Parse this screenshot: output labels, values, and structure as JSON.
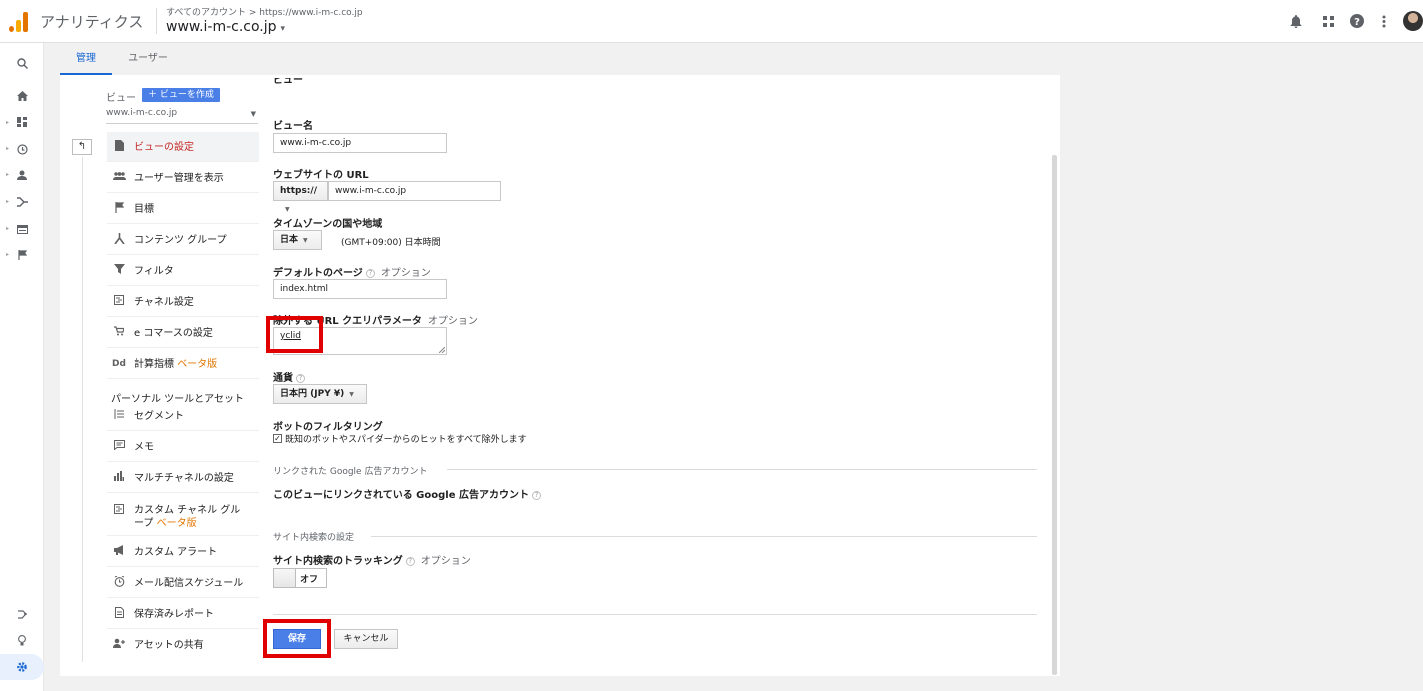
{
  "header": {
    "app_title": "アナリティクス",
    "breadcrumb": "すべてのアカウント > https://www.i-m-c.co.jp",
    "property": "www.i-m-c.co.jp",
    "property_caret": "▾",
    "icons": [
      "bell-icon",
      "apps-grid-icon",
      "help-icon",
      "more-vert-icon"
    ]
  },
  "rail": {
    "icons": [
      "search-icon",
      "home-icon",
      "customization-icon",
      "realtime-icon",
      "audience-icon",
      "acquisition-icon",
      "behavior-icon",
      "conversions-icon",
      "attribution-icon",
      "discover-icon",
      "admin-icon"
    ]
  },
  "tabs": [
    {
      "label": "管理"
    },
    {
      "label": "ユーザー"
    }
  ],
  "sidebar": {
    "view_label": "ビュー",
    "create_view_label": "＋ ビューを作成",
    "view_select_value": "www.i-m-c.co.jp",
    "back_icon": "back-arrow-icon",
    "section_header": "パーソナル ツールとアセット",
    "items": [
      {
        "label": "ビューの設定",
        "icon": "document-icon"
      },
      {
        "label": "ユーザー管理を表示",
        "icon": "people-icon"
      },
      {
        "label": "目標",
        "icon": "flag-icon"
      },
      {
        "label": "コンテンツ グループ",
        "icon": "content-group-icon"
      },
      {
        "label": "フィルタ",
        "icon": "filter-icon"
      },
      {
        "label": "チャネル設定",
        "icon": "channel-icon"
      },
      {
        "label": "e コマースの設定",
        "icon": "cart-icon"
      },
      {
        "label": "計算指標",
        "beta": "ベータ版",
        "icon": "dd-icon"
      },
      {
        "label": "セグメント",
        "icon": "segment-icon"
      },
      {
        "label": "メモ",
        "icon": "note-icon"
      },
      {
        "label": "マルチチャネルの設定",
        "icon": "bar-chart-icon"
      },
      {
        "label": "カスタム チャネル グル",
        "label2": "ープ",
        "beta": "ベータ版",
        "icon": "custom-channel-icon"
      },
      {
        "label": "カスタム アラート",
        "icon": "megaphone-icon"
      },
      {
        "label": "メール配信スケジュール",
        "icon": "schedule-icon"
      },
      {
        "label": "保存済みレポート",
        "icon": "saved-report-icon"
      },
      {
        "label": "アセットの共有",
        "icon": "share-person-icon"
      }
    ]
  },
  "form": {
    "view_name_label": "ビュー名",
    "view_name_value": "www.i-m-c.co.jp",
    "website_url_label": "ウェブサイトの URL",
    "protocol_value": "https://",
    "website_url_value": "www.i-m-c.co.jp",
    "timezone_label": "タイムゾーンの国や地域",
    "timezone_country": "日本",
    "timezone_value": "(GMT+09:00) 日本時間",
    "default_page_label": "デフォルトのページ",
    "default_page_optional": "オプション",
    "default_page_value": "index.html",
    "exclude_params_label": "除外する URL クエリパラメータ",
    "exclude_params_optional": "オプション",
    "exclude_params_value": "yclid",
    "currency_label": "通貨",
    "currency_value": "日本円 (JPY ¥)",
    "bot_filter_label": "ボットのフィルタリング",
    "bot_filter_checkbox": "既知のボットやスパイダーからのヒットをすべて除外します",
    "bot_filter_checked": true,
    "linked_ads_section": "リンクされた Google 広告アカウント",
    "linked_ads_label": "このビューにリンクされている Google 広告アカウント",
    "site_search_section": "サイト内検索の設定",
    "site_search_label": "サイト内検索のトラッキング",
    "site_search_optional": "オプション",
    "site_search_toggle": "オフ",
    "save_button": "保存",
    "cancel_button": "キャンセル"
  },
  "colors": {
    "accent": "#1967d2",
    "save_button": "#4a7fe8",
    "highlight_box": "#e10000",
    "active_nav_text": "#c62828",
    "beta": "#e37400"
  }
}
